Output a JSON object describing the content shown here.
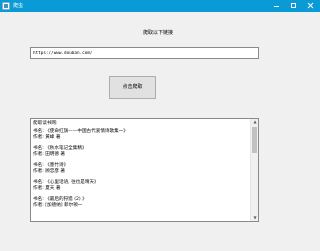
{
  "window": {
    "title": "爬虫"
  },
  "heading": "爬取以下链接",
  "url_input": {
    "value": "https://www.douban.com/"
  },
  "fetch_button": {
    "label": "点击爬取"
  },
  "results": {
    "header": "爬取读书网:",
    "books": [
      {
        "title": "书名: 《使命红旗——中国古代爱情诗歌集一》",
        "author": "作者: 黄峰 著"
      },
      {
        "title": "书名: 《秋水笔记全集精》",
        "author": "作者: 田明德 著"
      },
      {
        "title": "书名: 《墨竹诗》",
        "author": "作者: 顾忠彦 著"
      },
      {
        "title": "书名: 《心里话语, 往也是晴天》",
        "author": "作者: 夏天 著"
      },
      {
        "title": "书名: 《最后的狩猎 (2) 》",
        "author": "作者: [加德纳] 菲尔顿一"
      }
    ]
  }
}
